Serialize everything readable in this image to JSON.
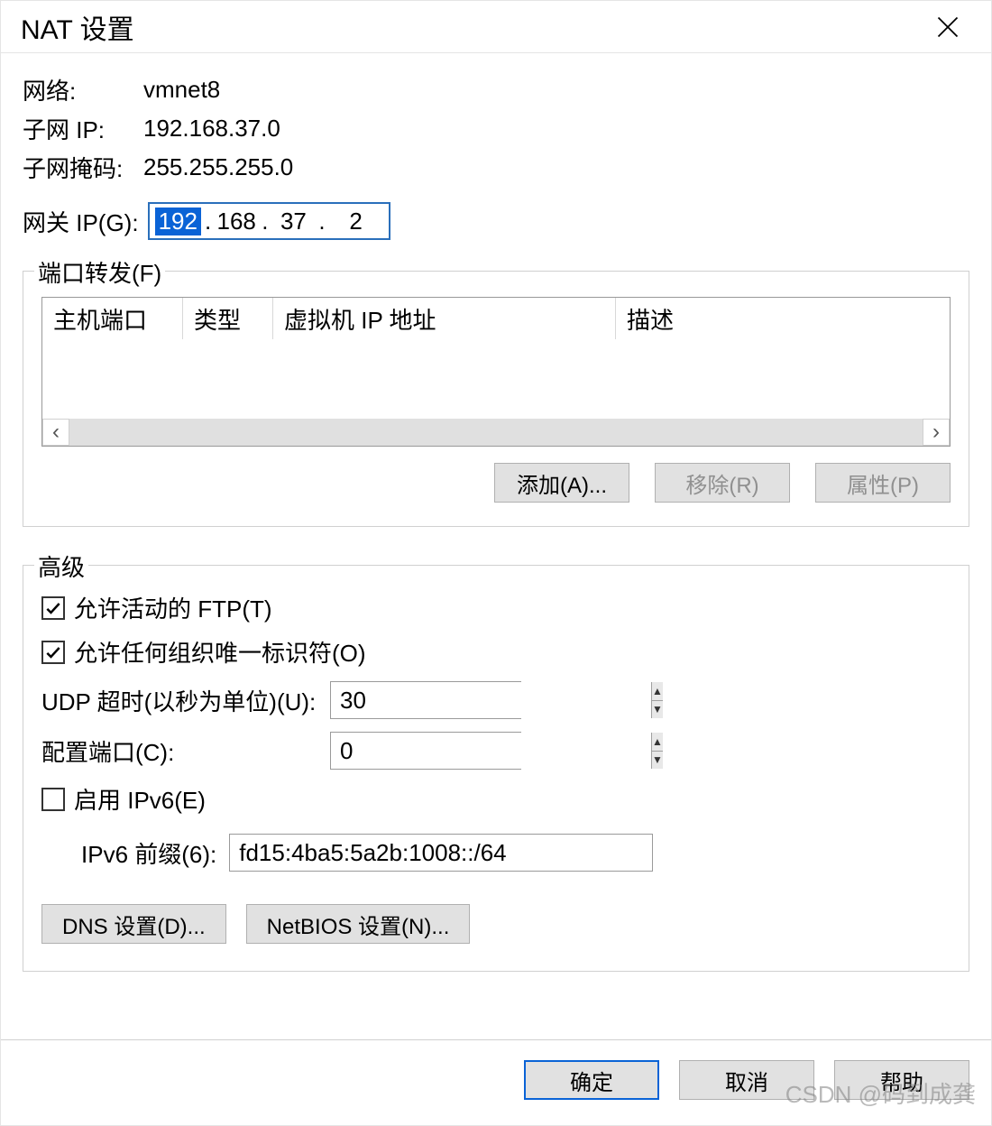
{
  "title": "NAT 设置",
  "info": {
    "network_label": "网络:",
    "network_value": "vmnet8",
    "subnet_ip_label": "子网 IP:",
    "subnet_ip_value": "192.168.37.0",
    "subnet_mask_label": "子网掩码:",
    "subnet_mask_value": "255.255.255.0"
  },
  "gateway": {
    "label": "网关 IP(G):",
    "octets": [
      "192",
      "168",
      "37",
      "2"
    ]
  },
  "port_forward": {
    "legend": "端口转发(F)",
    "columns": {
      "host_port": "主机端口",
      "type": "类型",
      "vm_ip": "虚拟机 IP 地址",
      "desc": "描述"
    },
    "buttons": {
      "add": "添加(A)...",
      "remove": "移除(R)",
      "properties": "属性(P)"
    }
  },
  "advanced": {
    "legend": "高级",
    "allow_active_ftp": "允许活动的 FTP(T)",
    "allow_any_oui": "允许任何组织唯一标识符(O)",
    "udp_timeout_label": "UDP 超时(以秒为单位)(U):",
    "udp_timeout_value": "30",
    "config_port_label": "配置端口(C):",
    "config_port_value": "0",
    "enable_ipv6_label": "启用 IPv6(E)",
    "ipv6_prefix_label": "IPv6 前缀(6):",
    "ipv6_prefix_value": "fd15:4ba5:5a2b:1008::/64",
    "dns_btn": "DNS 设置(D)...",
    "netbios_btn": "NetBIOS 设置(N)..."
  },
  "dialog_buttons": {
    "ok": "确定",
    "cancel": "取消",
    "help": "帮助"
  },
  "watermark": "CSDN @码到成龚"
}
